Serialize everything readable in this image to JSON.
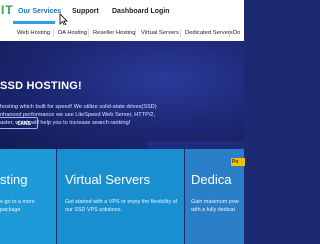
{
  "brand": {
    "logo_text": "IT",
    "accent": "#2ea349"
  },
  "nav": {
    "items": [
      {
        "label": "Our Services",
        "active": true
      },
      {
        "label": "Support",
        "active": false
      },
      {
        "label": "Dashboard Login",
        "active": false
      }
    ],
    "active_color": "#1e73be"
  },
  "subnav": {
    "items": [
      "Web Hosting",
      "DA Hosting",
      "Reseller Hosting",
      "Virtual Servers",
      "Dedicated Servers",
      "Do"
    ]
  },
  "hero": {
    "title": "SSD HOSTING!",
    "lines": [
      "hosting which built for speed! We utilize solid-state drives(SSD)",
      "nhanced performance we use LiteSpeed Web Server, HTTP/2,",
      "aster, which will help you to increase search ranking!"
    ],
    "plans_label": "LANS"
  },
  "cards": [
    {
      "title": "sting",
      "text_lines": [
        "e go to a more",
        "package"
      ],
      "color": "#1f9ad8"
    },
    {
      "title": "Virtual Servers",
      "text_lines": [
        "Get started with a VPS or enjoy the flexibility of",
        "our SSD VPS solutions."
      ],
      "color": "#1a8fd0"
    },
    {
      "title": "Dedica",
      "text_lines": [
        "Gain maximum pow",
        "with a fully dedicat"
      ],
      "color": "#2a7fc6",
      "badge": "Po"
    }
  ]
}
